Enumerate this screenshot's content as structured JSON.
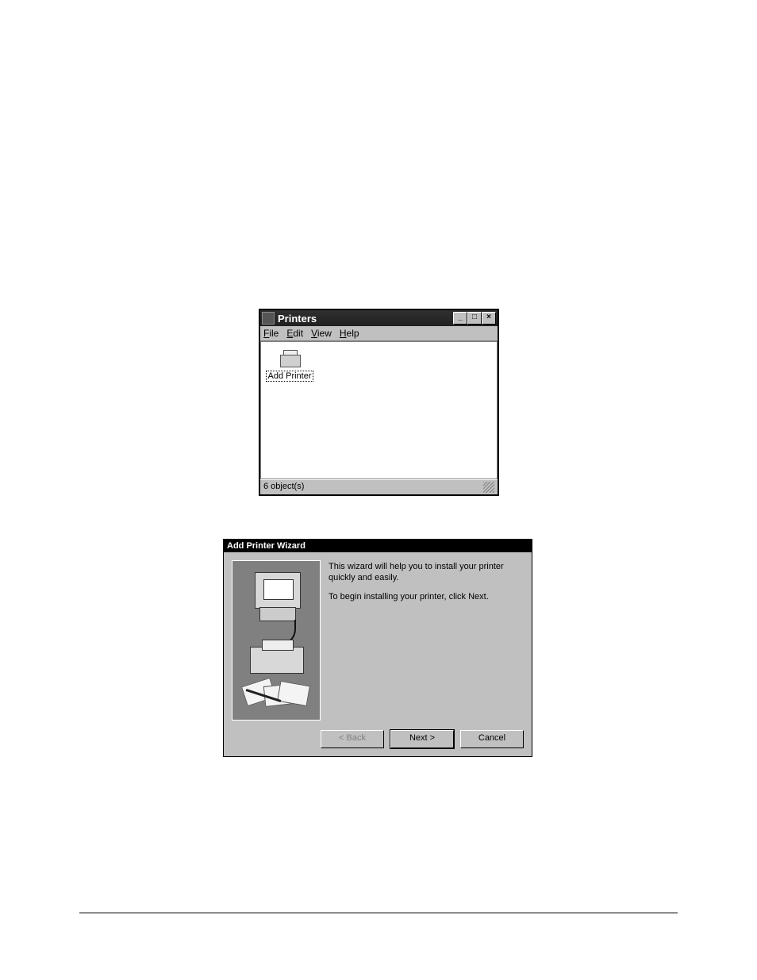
{
  "printers_window": {
    "title": "Printers",
    "menu": {
      "file": "File",
      "edit": "Edit",
      "view": "View",
      "help": "Help"
    },
    "item_label": "Add Printer",
    "status": "6 object(s)",
    "controls": {
      "min": "_",
      "max": "□",
      "close": "×"
    }
  },
  "wizard": {
    "title": "Add Printer Wizard",
    "para1": "This wizard will help you to install your printer quickly and easily.",
    "para2": "To begin installing your printer, click Next.",
    "back": "< Back",
    "next": "Next >",
    "cancel": "Cancel"
  }
}
